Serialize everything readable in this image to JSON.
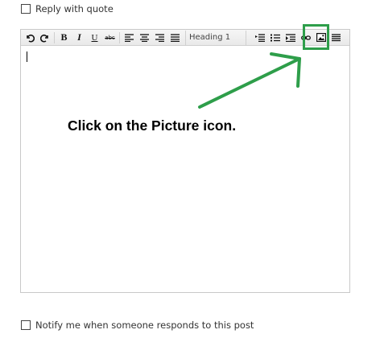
{
  "reply_with_quote": {
    "label": "Reply with quote",
    "checked": false
  },
  "toolbar": {
    "buttons": [
      {
        "name": "undo",
        "glyph": "↶"
      },
      {
        "name": "redo",
        "glyph": "↷"
      },
      {
        "name": "bold",
        "glyph": "B"
      },
      {
        "name": "italic",
        "glyph": "I"
      },
      {
        "name": "underline",
        "glyph": "U"
      },
      {
        "name": "strikethrough",
        "glyph": "abc"
      },
      {
        "name": "align-left",
        "glyph": "≡"
      },
      {
        "name": "align-center",
        "glyph": "≡"
      },
      {
        "name": "align-right",
        "glyph": "≡"
      },
      {
        "name": "justify",
        "glyph": "≡"
      }
    ],
    "heading_select": "Heading 1",
    "right_buttons": [
      {
        "name": "bulleted-list",
        "glyph": "☰"
      },
      {
        "name": "numbered-list",
        "glyph": "☷"
      },
      {
        "name": "indent",
        "glyph": "⇥"
      },
      {
        "name": "link",
        "glyph": "⊸"
      },
      {
        "name": "picture",
        "glyph": "▣"
      },
      {
        "name": "more",
        "glyph": "▤"
      }
    ]
  },
  "annotation": {
    "instruction": "Click on the Picture icon.",
    "accent_color": "#2e9e4a"
  },
  "notify": {
    "label": "Notify me when someone responds to this post",
    "checked": false
  }
}
